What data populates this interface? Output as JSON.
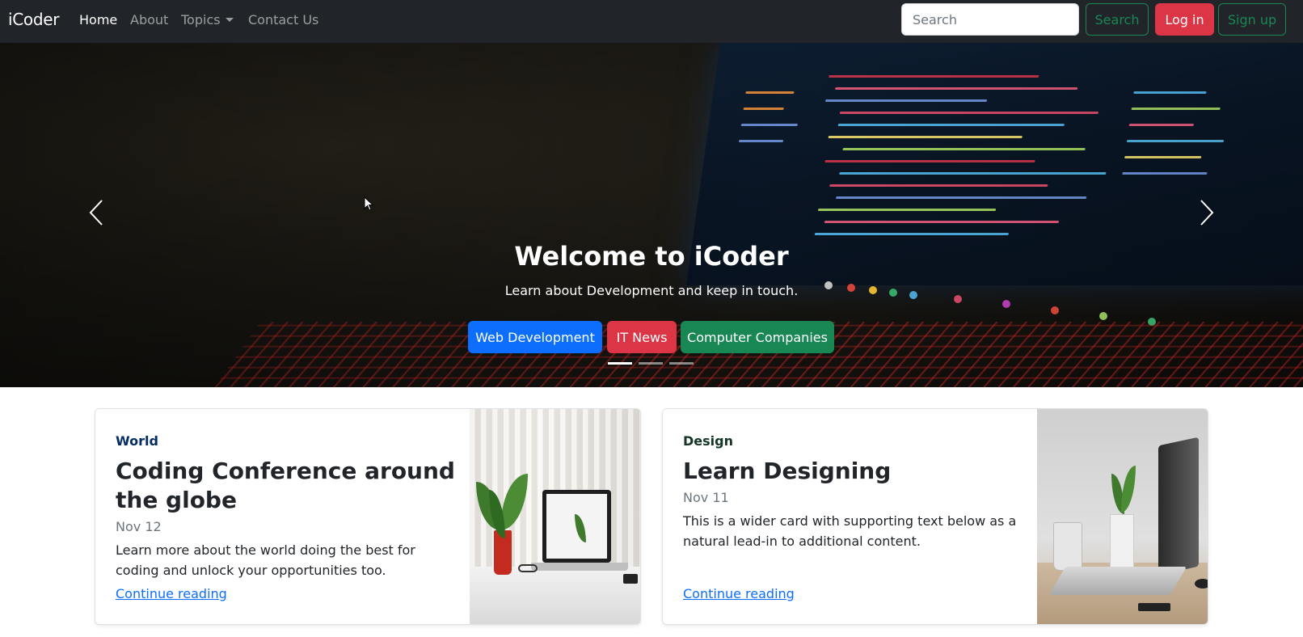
{
  "navbar": {
    "brand": "iCoder",
    "links": [
      {
        "label": "Home",
        "active": true
      },
      {
        "label": "About",
        "active": false
      },
      {
        "label": "Topics",
        "active": false,
        "dropdown": true
      },
      {
        "label": "Contact Us",
        "active": false
      }
    ],
    "search_placeholder": "Search",
    "search_button": "Search",
    "login_button": "Log in",
    "signup_button": "Sign up"
  },
  "hero": {
    "title": "Welcome to iCoder",
    "subtitle": "Learn about Development and keep in touch.",
    "buttons": [
      {
        "label": "Web Development",
        "color": "#0d6efd"
      },
      {
        "label": "IT News",
        "color": "#dc3545"
      },
      {
        "label": "Computer Companies",
        "color": "#198754"
      }
    ],
    "indicators": {
      "count": 3,
      "active_index": 0
    },
    "controls": {
      "prev_icon": "chevron-left-icon",
      "next_icon": "chevron-right-icon"
    }
  },
  "cards": [
    {
      "category": "World",
      "title": "Coding Conference around the globe",
      "date": "Nov 12",
      "text": "Learn more about the world doing the best for coding and unlock your opportunities too.",
      "link": "Continue reading"
    },
    {
      "category": "Design",
      "title": "Learn Designing",
      "date": "Nov 11",
      "text": "This is a wider card with supporting text below as a natural lead-in to additional content.",
      "link": "Continue reading"
    }
  ],
  "colors": {
    "navbar_bg": "#212529",
    "primary": "#0d6efd",
    "danger": "#dc3545",
    "success": "#198754"
  }
}
